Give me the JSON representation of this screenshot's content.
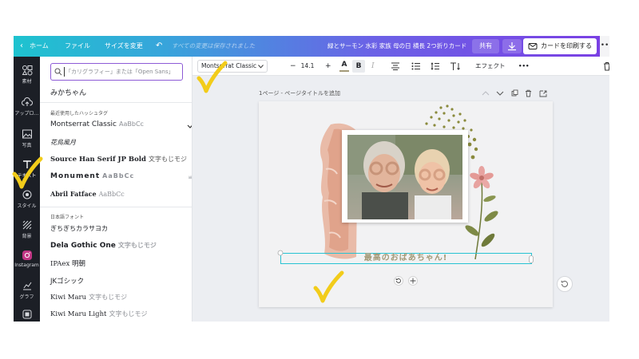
{
  "topbar": {
    "home_label": "ホーム",
    "file_label": "ファイル",
    "resize_label": "サイズを変更",
    "save_status": "すべての変更は保存されました",
    "doc_title": "緑とサーモン 水彩 家族 母の日 横長 2つ折りカード",
    "share_label": "共有",
    "print_label": "カードを印刷する"
  },
  "rail": {
    "items": [
      {
        "label": "素材",
        "icon": "elements-icon"
      },
      {
        "label": "アップロ…",
        "icon": "upload-icon"
      },
      {
        "label": "写真",
        "icon": "photo-icon"
      },
      {
        "label": "テキスト",
        "icon": "text-icon"
      },
      {
        "label": "スタイル",
        "icon": "style-icon"
      },
      {
        "label": "背景",
        "icon": "background-icon"
      },
      {
        "label": "Instagram",
        "icon": "instagram-icon"
      },
      {
        "label": "グラフ",
        "icon": "chart-icon"
      }
    ]
  },
  "panel": {
    "search_placeholder": "「カリグラフィー」または「Open Sans」",
    "recent_font": "みかちゃん",
    "recent_section": "最近使用したハッシュタグ",
    "recent_fonts": [
      {
        "name": "Montserrat Classic",
        "sample": "AaBbCc"
      },
      {
        "name": "花鳥風月",
        "sample": ""
      },
      {
        "name": "Source Han Serif JP Bold",
        "sample": "文字もじモジ"
      },
      {
        "name": "Monument",
        "sample": "AaBbCc"
      },
      {
        "name": "Abril Fatface",
        "sample": "AaBbCc"
      }
    ],
    "jp_section": "日本語フォント",
    "jp_fonts": [
      {
        "name": "ぎちぎちカラサヨカ",
        "sample": ""
      },
      {
        "name": "Dela Gothic One",
        "sample": "文字もじモジ"
      },
      {
        "name": "IPAex 明朝",
        "sample": ""
      },
      {
        "name": "JKゴシック",
        "sample": ""
      },
      {
        "name": "Kiwi Maru",
        "sample": "文字もじモジ"
      },
      {
        "name": "Kiwi Maru Light",
        "sample": "文字もじモジ"
      }
    ]
  },
  "toolbar": {
    "font_name": "Montserrat Classic",
    "minus": "−",
    "font_size": "14.1",
    "plus": "+",
    "text_color_label": "A",
    "bold_label": "B",
    "italic_label": "I",
    "effects_label": "エフェクト",
    "more_label": "•••"
  },
  "canvas": {
    "page_label": "1ページ - ページタイトルを追加",
    "title_text": "最高のおばあちゃん!"
  },
  "colors": {
    "accent_purple": "#8d5bd6",
    "selection_cyan": "#27c3d2",
    "checkmark_yellow": "#f2cc1a"
  }
}
